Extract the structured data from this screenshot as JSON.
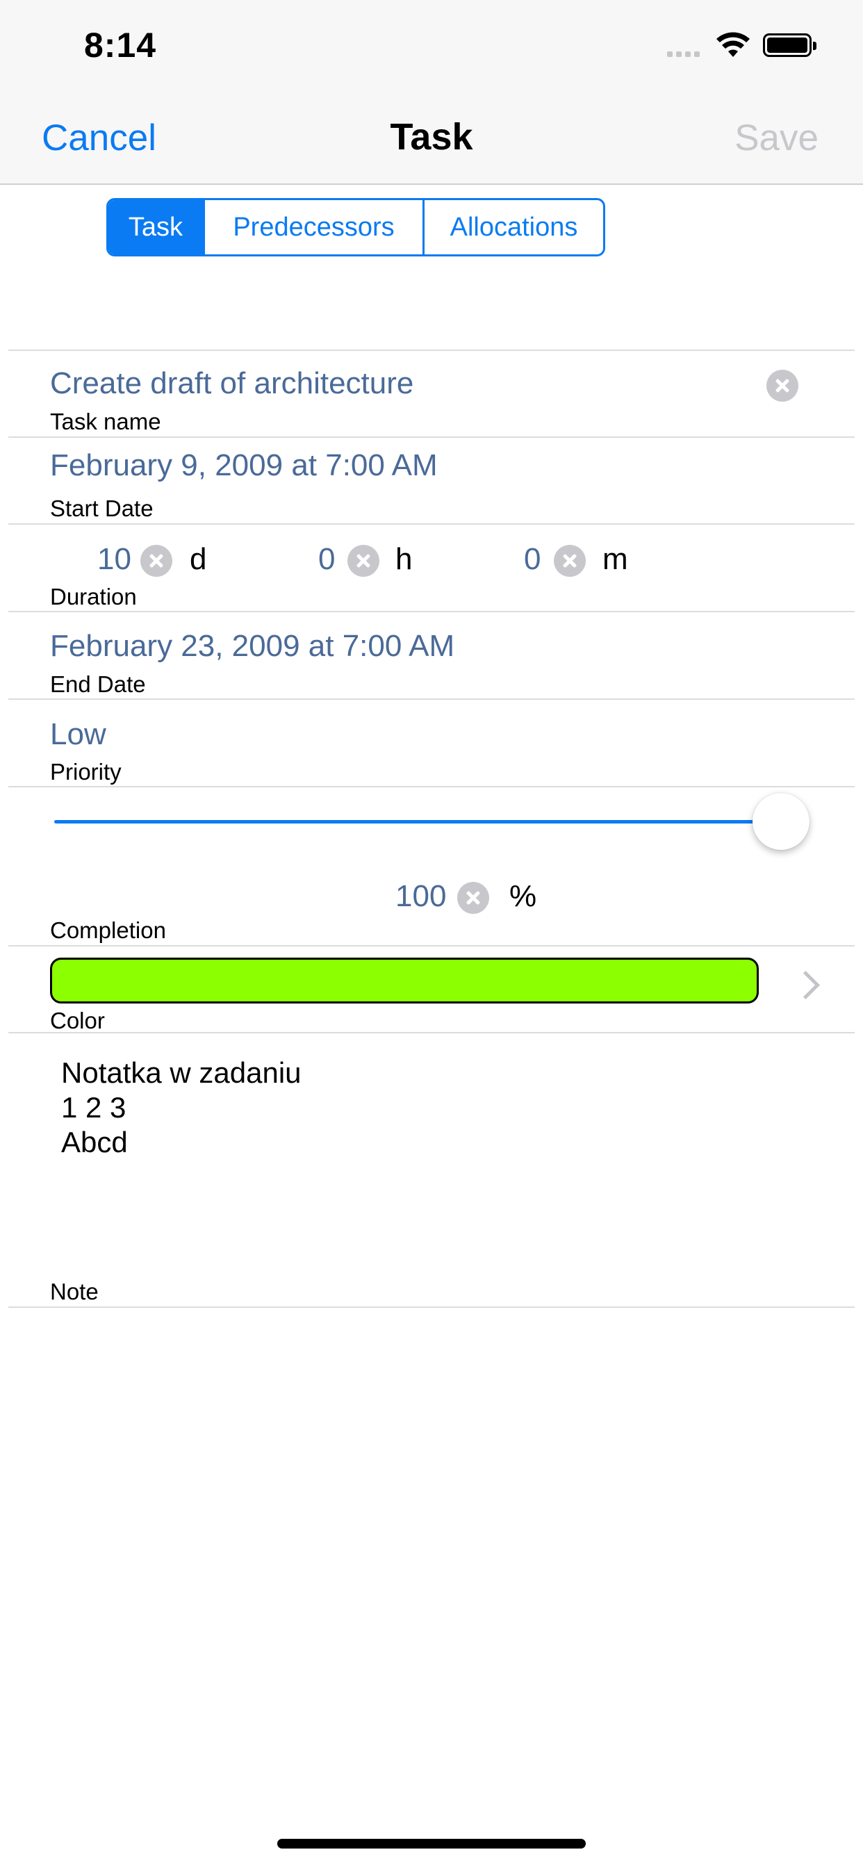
{
  "status_bar": {
    "time": "8:14"
  },
  "nav": {
    "cancel": "Cancel",
    "title": "Task",
    "save": "Save"
  },
  "segments": [
    "Task",
    "Predecessors",
    "Allocations"
  ],
  "fields": {
    "task_name": {
      "value": "Create draft of architecture",
      "label": "Task name"
    },
    "start_date": {
      "value": "February 9, 2009 at 7:00 AM",
      "label": "Start Date"
    },
    "duration": {
      "days": "10",
      "days_unit": "d",
      "hours": "0",
      "hours_unit": "h",
      "minutes": "0",
      "minutes_unit": "m",
      "label": "Duration"
    },
    "end_date": {
      "value": "February 23, 2009 at 7:00 AM",
      "label": "End Date"
    },
    "priority": {
      "value": "Low",
      "label": "Priority"
    },
    "completion": {
      "value": "100",
      "unit": "%",
      "label": "Completion",
      "slider_fraction": 1.0
    },
    "color": {
      "label": "Color",
      "swatch": "#8cff00"
    },
    "note": {
      "lines": [
        "Notatka w zadaniu",
        "1 2 3",
        "Abcd"
      ],
      "label": "Note"
    }
  },
  "colors": {
    "accent": "#0a7bf2",
    "value_text": "#4a6a98",
    "disabled": "#c7c7cc"
  }
}
